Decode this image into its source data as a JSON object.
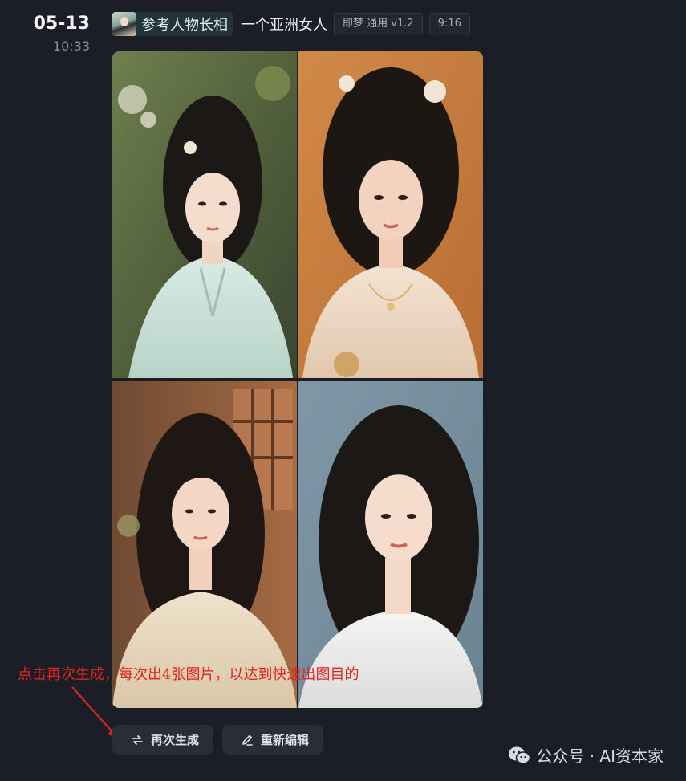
{
  "record": {
    "date": "05-13",
    "time": "10:33"
  },
  "header": {
    "ref_label": "参考人物长相",
    "prompt": "一个亚洲女人",
    "model_tag": "即梦 通用 v1.2",
    "ratio_tag": "9:16"
  },
  "images": [
    {
      "description_icon": "portrait-image-1"
    },
    {
      "description_icon": "portrait-image-2"
    },
    {
      "description_icon": "portrait-image-3"
    },
    {
      "description_icon": "portrait-image-4"
    }
  ],
  "actions": {
    "regenerate_label": "再次生成",
    "reedit_label": "重新编辑"
  },
  "annotation": {
    "text": "点击再次生成，每次出4张图片，以达到快速出图目的",
    "color": "#e0251f"
  },
  "watermark": {
    "text": "公众号 · AI资本家"
  },
  "colors": {
    "background": "#1b1e26",
    "button_bg": "#2a2d38",
    "accent_red": "#e0251f"
  }
}
